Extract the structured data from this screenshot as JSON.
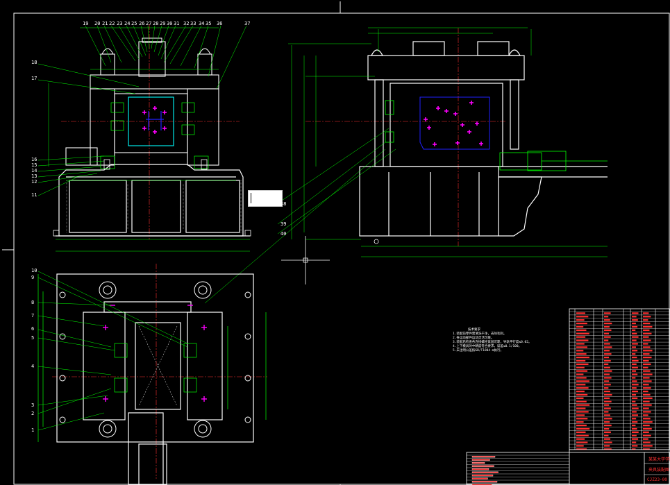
{
  "drawing": {
    "colors": {
      "background": "#000000",
      "outline": "#ffffff",
      "dimension": "#00ff00",
      "centerline": "#ff3030",
      "hidden": "#00ffff",
      "bolt_marker": "#ff00ff",
      "bolt_cross": "#2020ff"
    },
    "front_view_balloons": [
      "19",
      "20",
      "21",
      "22",
      "23",
      "24",
      "25",
      "26",
      "27",
      "28",
      "29",
      "30",
      "31",
      "32",
      "33",
      "34",
      "35",
      "36",
      "37"
    ],
    "left_balloons": [
      "18",
      "17",
      "16",
      "15",
      "14",
      "13",
      "12",
      "11"
    ],
    "mid_balloons": [
      "38",
      "39",
      "40"
    ],
    "plan_balloons": [
      "10",
      "9",
      "8",
      "7",
      "6",
      "5",
      "4",
      "3",
      "2",
      "1"
    ],
    "tech_notes": {
      "heading": "技术要求",
      "lines": [
        "1.装配前零件需清洗干净，去除毛刺。",
        "2.各运动部件运动灵活可靠。",
        "3.装配后检查各连接螺栓紧固可靠，导轨平行度≤0.02。",
        "4.上下模具对中精度符合要求，误差≤0.1/100。",
        "5.未注明公差按GB/T1804-m执行。"
      ]
    },
    "title_block": {
      "school": "某某大学学院",
      "title": "夹具装配图",
      "drawing_no": "CJZ23-00"
    }
  }
}
